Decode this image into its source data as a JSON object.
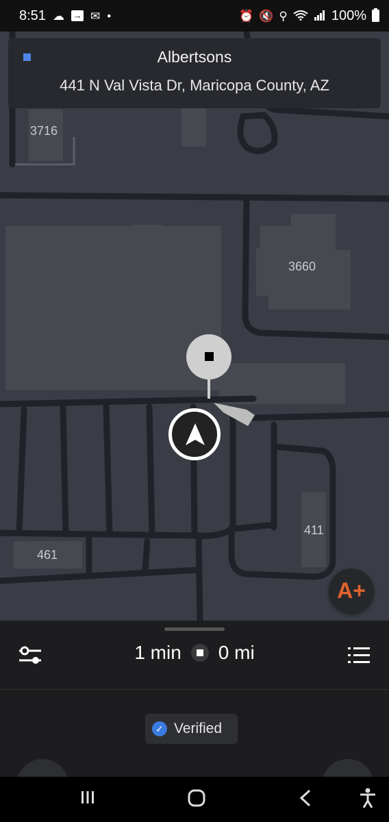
{
  "status_bar": {
    "time": "8:51",
    "left_icons": [
      "cloud-icon",
      "arrow-box-icon",
      "mail-icon",
      "dot-icon"
    ],
    "right_icons": [
      "alarm-icon",
      "mute-icon",
      "location-icon",
      "wifi-icon",
      "signal-icon",
      "battery-icon"
    ],
    "battery": "100%"
  },
  "destination": {
    "name": "Albertsons",
    "address": "441 N Val Vista Dr, Maricopa County, AZ"
  },
  "map": {
    "labels": {
      "a": "3716",
      "b": "3660",
      "c": "411",
      "d": "461"
    },
    "report_button": "A+"
  },
  "trip": {
    "eta": "1 min",
    "distance": "0 mi"
  },
  "verified": {
    "label": "Verified"
  },
  "colors": {
    "map_bg": "#3a3d45",
    "road": "#1f2228",
    "building": "#4a4d55",
    "accent_orange": "#e0622d",
    "verified_blue": "#3b7be0"
  }
}
